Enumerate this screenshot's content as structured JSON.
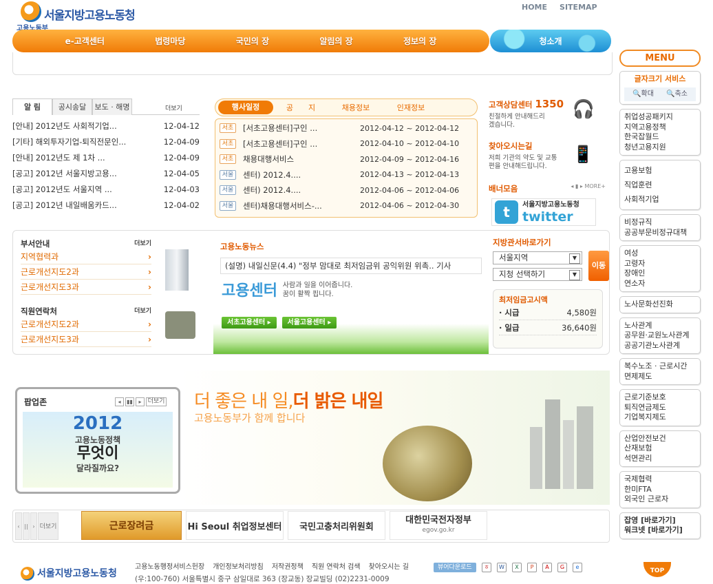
{
  "header": {
    "org_name": "서울지방고용노동청",
    "org_sub": "고용노동부",
    "home": "HOME",
    "sitemap": "SITEMAP"
  },
  "nav": {
    "items": [
      "e-고객센터",
      "법령마당",
      "국민의 장",
      "알림의 장",
      "정보의 장"
    ],
    "intro": "청소개"
  },
  "notices": {
    "tabs": [
      "알 림",
      "공시송달",
      "보도 · 해명"
    ],
    "more": "더보기",
    "rows": [
      {
        "title": "[안내] 2012년도 사회적기업...",
        "date": "12-04-12"
      },
      {
        "title": "[기타] 해외투자기업-퇴직전문인...",
        "date": "12-04-09"
      },
      {
        "title": "[안내] 2012년도 제 1차 ...",
        "date": "12-04-09"
      },
      {
        "title": "[공고] 2012년 서울지방고용...",
        "date": "12-04-05"
      },
      {
        "title": "[공고] 2012년도 서울지역 ...",
        "date": "12-04-03"
      },
      {
        "title": "[공고] 2012년 내일배움카드...",
        "date": "12-04-02"
      }
    ]
  },
  "events": {
    "tabs": [
      "행사일정",
      "공　　지",
      "채용정보",
      "인재정보"
    ],
    "rows": [
      {
        "badge": "서초",
        "title": "[서초고용센터]구인 ...",
        "date": "2012-04-12 ~ 2012-04-12"
      },
      {
        "badge": "서초",
        "title": "[서초고용센터]구인 ...",
        "date": "2012-04-10 ~ 2012-04-10"
      },
      {
        "badge": "서초",
        "title": "채용대행서비스",
        "date": "2012-04-09 ~ 2012-04-16"
      },
      {
        "badge": "서울",
        "title": "센터) 2012.4....",
        "date": "2012-04-13 ~ 2012-04-13"
      },
      {
        "badge": "서울",
        "title": "센터) 2012.4....",
        "date": "2012-04-06 ~ 2012-04-06"
      },
      {
        "badge": "서울",
        "title": "센터)채용대행서비스-...",
        "date": "2012-04-06 ~ 2012-04-30"
      }
    ]
  },
  "info": {
    "call_title": "고객상담센터",
    "call_num": "1350",
    "call_desc": "친절하게 안내해드리겠습니다.",
    "find_title": "찾아오시는길",
    "find_desc": "저희 기관의 약도 및 교통편을 안내해드립니다.",
    "banner_title": "배너모음",
    "banner_more": "MORE+",
    "twitter_org": "서울지방고용노동청",
    "twitter": "twitter"
  },
  "dept": {
    "title": "부서안내",
    "more": "더보기",
    "items": [
      "지역협력과",
      "근로개선지도2과",
      "근로개선지도3과"
    ],
    "contact_title": "직원연락처",
    "contact_items": [
      "근로개선지도2과",
      "근로개선지도3과"
    ]
  },
  "news": {
    "title": "고용노동뉴스",
    "headline": "(설명) 내일신문(4.4) \"정부 맘대로 최저임금위 공익위원 위촉.. 기사",
    "center": "고용센터",
    "center_desc1": "사람과 일을 이어줍니다.",
    "center_desc2": "꿈이 활짝 핍니다.",
    "btn1": "서초고용센터 ▸",
    "btn2": "서울고용센터 ▸"
  },
  "office": {
    "title": "지방관서바로가기",
    "sel1": "서울지역",
    "sel2": "지청 선택하기",
    "go": "이동"
  },
  "wage": {
    "title": "최저임금고시액",
    "rows": [
      {
        "label": "· 시급",
        "value": "4,580원"
      },
      {
        "label": "· 일급",
        "value": "36,640원"
      }
    ]
  },
  "popup": {
    "title": "팝업존",
    "more": "더보기",
    "year": "2012",
    "l1": "고용노동정책",
    "l2": "무엇이",
    "l3": "달라질까요?"
  },
  "visual": {
    "slogan_a": "더 좋은 내 일,",
    "slogan_b": "더 밝은 내일",
    "slogan2": "고용노동부가 함께 합니다"
  },
  "banners": {
    "more": "더보기",
    "b1": "근로장려금",
    "b2": "Hi Seoul 취업정보센터",
    "b3": "국민고충처리위원회",
    "b4": "대한민국전자정부",
    "b4_sub": "egov.go.kr"
  },
  "sidebar": {
    "menu": "MENU",
    "font_title": "글자크기 서비스",
    "zoom_in": "확대",
    "zoom_out": "축소",
    "groups": [
      [
        "취업성공패키지",
        "지역고용정책",
        "한국잡월드",
        "청년고용지원"
      ],
      [
        "고용보험",
        "직업훈련",
        "사회적기업"
      ],
      [
        "비정규직",
        "공공부문비정규대책"
      ],
      [
        "여성",
        "고령자",
        "장애인",
        "연소자"
      ],
      [
        "노사문화선진화"
      ],
      [
        "노사관계",
        "공무원·교원노사관계",
        "공공기관노사관계"
      ],
      [
        "복수노조 · 근로시간",
        "면제제도"
      ],
      [
        "근로기준보호",
        "퇴직연금제도",
        "기업복지제도"
      ],
      [
        "산업안전보건",
        "산재보험",
        "석면관리"
      ],
      [
        "국제협력",
        "한미FTA",
        "외국인 근로자"
      ]
    ],
    "job1": "잡영 [바로가기]",
    "job2": "워크넷 [바로가기]",
    "top": "TOP"
  },
  "footer": {
    "links": [
      "고용노동행정서비스헌장",
      "개인정보처리방침",
      "저작권정책",
      "직원 연락처 검색",
      "찾아오시는 길"
    ],
    "viewer": "뷰어다운로드",
    "address": "(우:100-760) 서울특별시 중구 삼일대로 363 (장교동) 장교빌딩 (02)2231-0009"
  }
}
